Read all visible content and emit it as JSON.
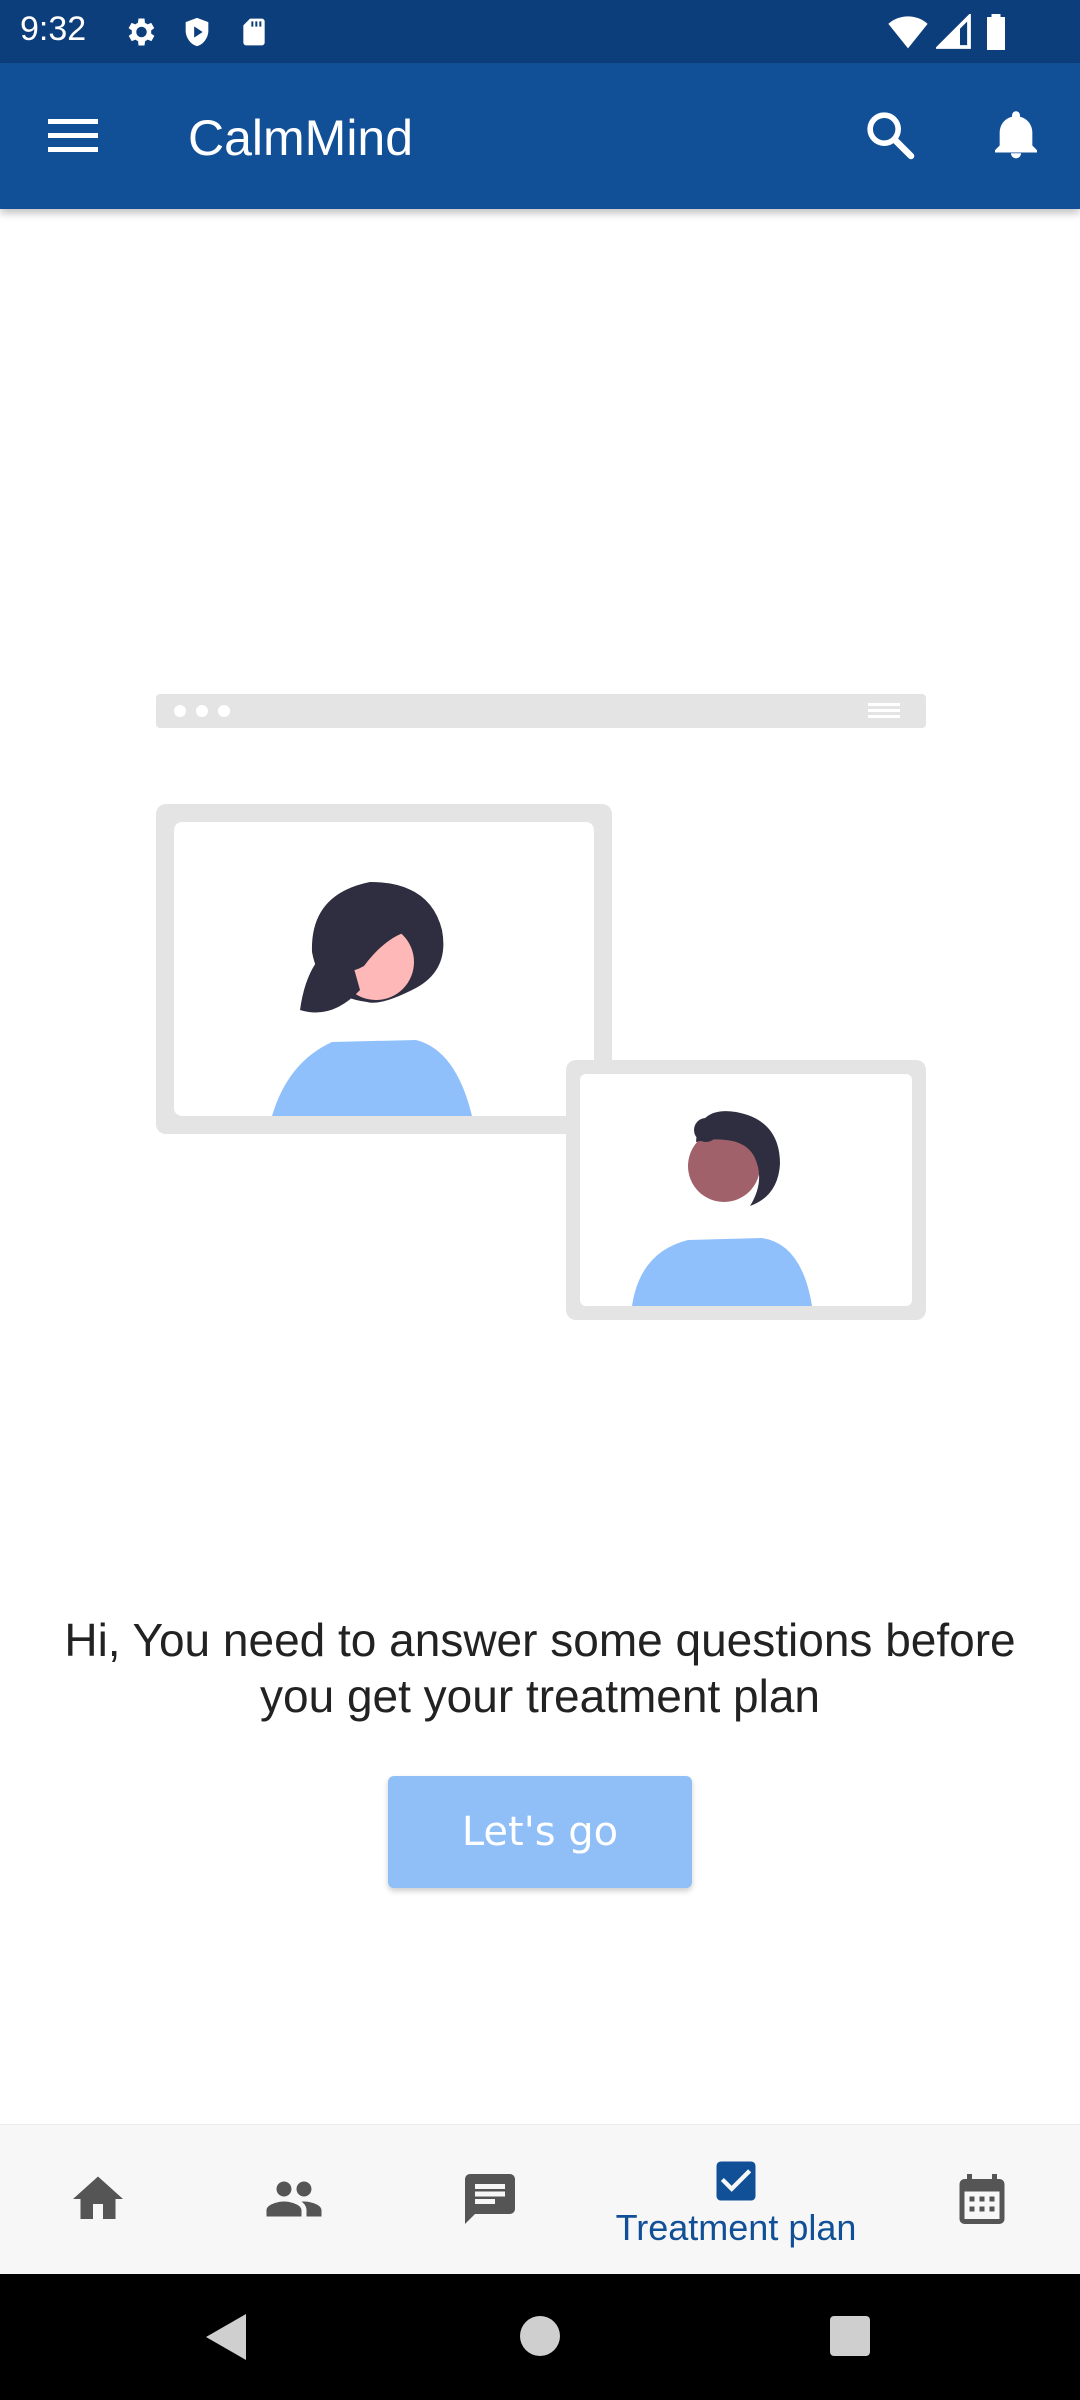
{
  "status_bar": {
    "time": "9:32",
    "icons": [
      "settings-icon",
      "shield-icon",
      "sd-card-icon",
      "wifi-icon",
      "cell-signal-icon",
      "battery-icon"
    ]
  },
  "app_bar": {
    "title": "CalmMind",
    "icons": [
      "menu-icon",
      "search-icon",
      "notification-bell-icon"
    ]
  },
  "main": {
    "message": "Hi, You need to answer some questions before you get your treatment plan",
    "button_label": "Let's go"
  },
  "bottom_nav": {
    "items": [
      {
        "icon": "home-icon",
        "label": ""
      },
      {
        "icon": "people-icon",
        "label": ""
      },
      {
        "icon": "chat-icon",
        "label": ""
      },
      {
        "icon": "checkbox-icon",
        "label": "Treatment plan",
        "active": true
      },
      {
        "icon": "calendar-icon",
        "label": ""
      }
    ]
  },
  "colors": {
    "status_bar": "#0d3e7c",
    "app_bar": "#114f97",
    "accent": "#114f97",
    "button": "#90bff8",
    "illustration_blue": "#8fc0fb"
  }
}
